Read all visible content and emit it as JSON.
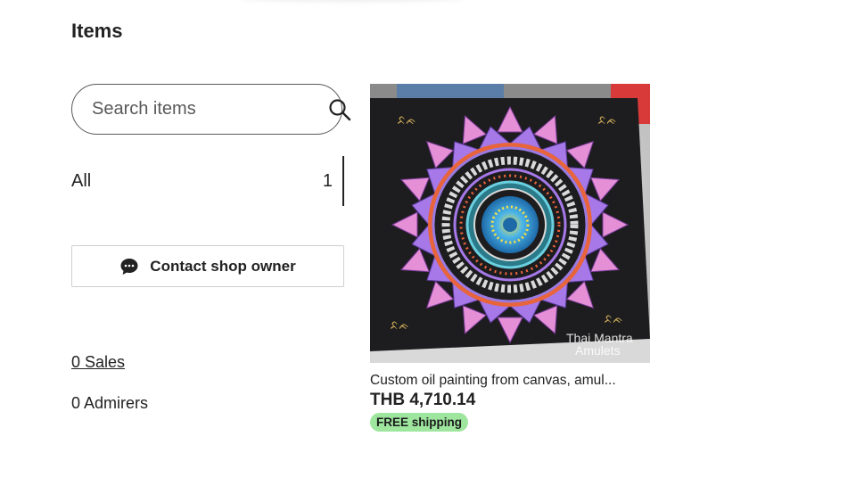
{
  "sidebar": {
    "heading": "Items",
    "search": {
      "placeholder": "Search items",
      "icon": "search-icon"
    },
    "sections": [
      {
        "label": "All",
        "count": "1",
        "selected": true
      }
    ],
    "contact_button": {
      "label": "Contact shop owner",
      "icon": "chat-bubble-icon"
    },
    "sales_link": "0 Sales",
    "admirers": "0 Admirers"
  },
  "listings": [
    {
      "title": "Custom oil painting from canvas, amul...",
      "price": "THB 4,710.14",
      "badge": "FREE shipping",
      "badge_color": "#9ee59e",
      "image": {
        "subject": "mandala-painting",
        "watermark_line1": "Thai Mantra",
        "watermark_line2": "Amulets"
      }
    }
  ],
  "colors": {
    "text": "#222222",
    "border": "#595959",
    "badge_bg": "#9ee59e"
  }
}
